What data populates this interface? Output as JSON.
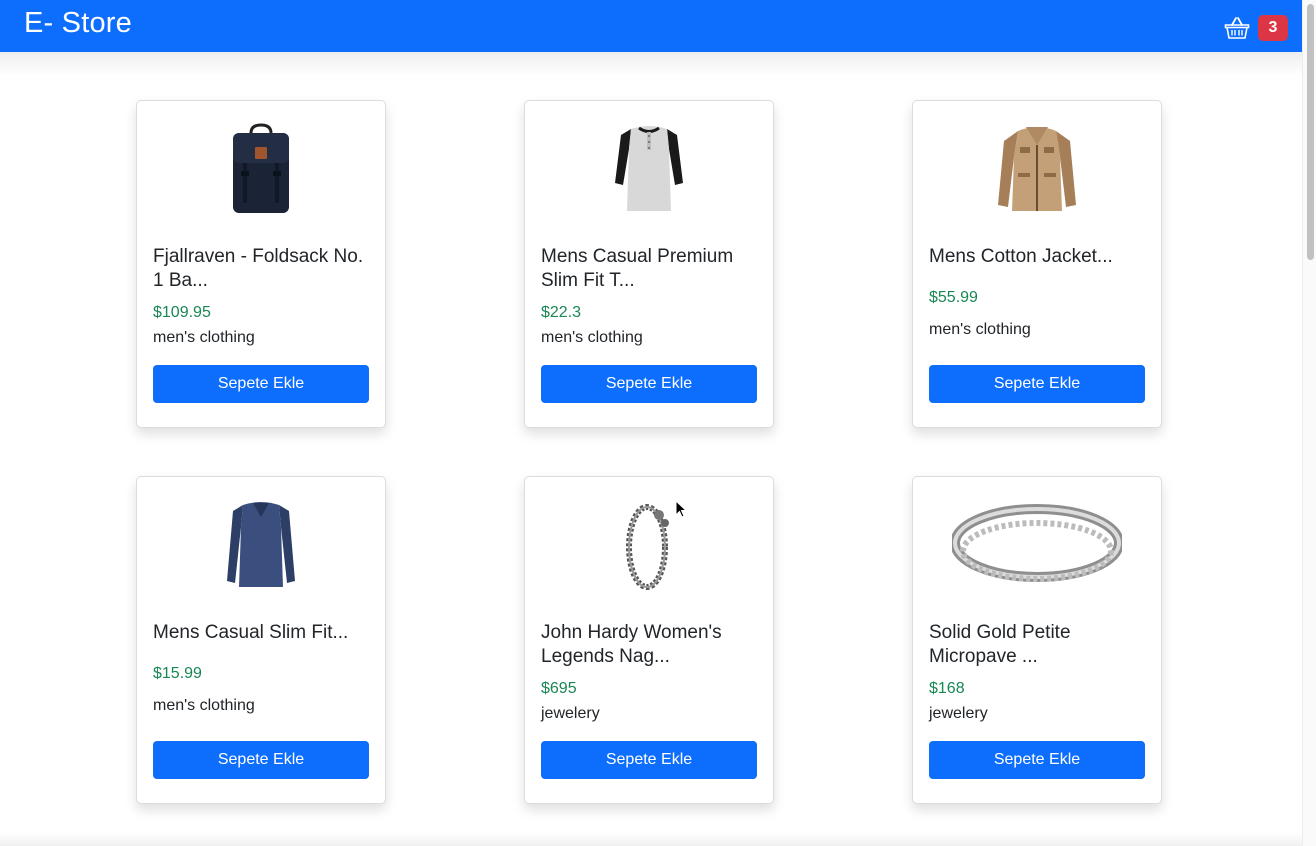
{
  "header": {
    "brand": "E- Store",
    "cart_count": "3"
  },
  "products": [
    {
      "title": "Fjallraven - Foldsack No. 1 Ba...",
      "price": "$109.95",
      "category": "men's clothing",
      "button": "Sepete Ekle",
      "image": "backpack-image"
    },
    {
      "title": "Mens Casual Premium Slim Fit T...",
      "price": "$22.3",
      "category": "men's clothing",
      "button": "Sepete Ekle",
      "image": "tshirt-image"
    },
    {
      "title": "Mens Cotton Jacket...",
      "price": "$55.99",
      "category": "men's clothing",
      "button": "Sepete Ekle",
      "image": "jacket-image"
    },
    {
      "title": "Mens Casual Slim Fit...",
      "price": "$15.99",
      "category": "men's clothing",
      "button": "Sepete Ekle",
      "image": "longsleeve-image"
    },
    {
      "title": "John Hardy Women's Legends Nag...",
      "price": "$695",
      "category": "jewelery",
      "button": "Sepete Ekle",
      "image": "bracelet-image"
    },
    {
      "title": "Solid Gold Petite Micropave ...",
      "price": "$168",
      "category": "jewelery",
      "button": "Sepete Ekle",
      "image": "ring-image"
    }
  ],
  "colors": {
    "primary": "#0d6efd",
    "price": "#198754",
    "badge": "#dc3545"
  }
}
